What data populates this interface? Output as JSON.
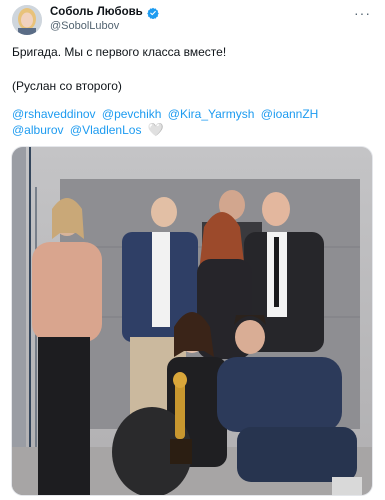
{
  "author": {
    "display_name": "Соболь Любовь",
    "handle": "@SobolLubov",
    "verified": true,
    "verified_color": "#1d9bf0"
  },
  "menu_icon": "more-horizontal-icon",
  "tweet": {
    "line1": "Бригада. Мы с первого класса вместе!",
    "line2": "(Руслан со второго)",
    "mentions": [
      "@rshaveddinov",
      "@pevchikh",
      "@Kira_Yarmysh",
      "@ioannZH",
      "@alburov",
      "@VladlenLos"
    ],
    "emoji": "🤍"
  },
  "colors": {
    "link": "#1d9bf0",
    "text": "#0f1419",
    "secondary": "#536471"
  }
}
